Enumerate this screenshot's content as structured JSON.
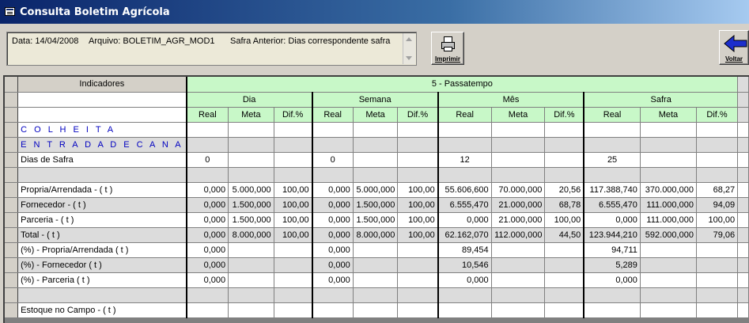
{
  "window": {
    "title": "Consulta Boletim Agrícola"
  },
  "info": {
    "data": "Data: 14/04/2008",
    "arquivo": "Arquivo: BOLETIM_AGR_MOD1",
    "safra": "Safra Anterior: Dias correspondente safra"
  },
  "toolbar": {
    "print_label": "Imprimir",
    "back_label": "Voltar"
  },
  "grid": {
    "indicadores_header": "Indicadores",
    "unit_header": "5 - Passatempo",
    "periods": [
      "Dia",
      "Semana",
      "Mês",
      "Safra"
    ],
    "sub": [
      "Real",
      "Meta",
      "Dif.%"
    ],
    "rows": [
      {
        "label": "C O L H E I T A",
        "section": true,
        "cells": [
          "",
          "",
          "",
          "",
          "",
          "",
          "",
          "",
          "",
          "",
          "",
          ""
        ]
      },
      {
        "label": "E N T R A D A  D E  C A N A",
        "section": true,
        "cells": [
          "",
          "",
          "",
          "",
          "",
          "",
          "",
          "",
          "",
          "",
          "",
          ""
        ]
      },
      {
        "label": "Dias de Safra",
        "cells": [
          "0",
          "",
          "",
          "0",
          "",
          "",
          "12",
          "",
          "",
          "25",
          "",
          ""
        ]
      },
      {
        "label": "",
        "cells": [
          "",
          "",
          "",
          "",
          "",
          "",
          "",
          "",
          "",
          "",
          "",
          ""
        ]
      },
      {
        "label": "Propria/Arrendada - ( t )",
        "cells": [
          "0,000",
          "5.000,000",
          "100,00",
          "0,000",
          "5.000,000",
          "100,00",
          "55.606,600",
          "70.000,000",
          "20,56",
          "117.388,740",
          "370.000,000",
          "68,27"
        ]
      },
      {
        "label": "Fornecedor - ( t )",
        "cells": [
          "0,000",
          "1.500,000",
          "100,00",
          "0,000",
          "1.500,000",
          "100,00",
          "6.555,470",
          "21.000,000",
          "68,78",
          "6.555,470",
          "111.000,000",
          "94,09"
        ]
      },
      {
        "label": "Parceria - ( t )",
        "cells": [
          "0,000",
          "1.500,000",
          "100,00",
          "0,000",
          "1.500,000",
          "100,00",
          "0,000",
          "21.000,000",
          "100,00",
          "0,000",
          "111.000,000",
          "100,00"
        ]
      },
      {
        "label": "Total - ( t )",
        "cells": [
          "0,000",
          "8.000,000",
          "100,00",
          "0,000",
          "8.000,000",
          "100,00",
          "62.162,070",
          "112.000,000",
          "44,50",
          "123.944,210",
          "592.000,000",
          "79,06"
        ]
      },
      {
        "label": "(%) - Propria/Arrendada ( t )",
        "cells": [
          "0,000",
          "",
          "",
          "0,000",
          "",
          "",
          "89,454",
          "",
          "",
          "94,711",
          "",
          ""
        ]
      },
      {
        "label": "(%) - Fornecedor ( t )",
        "cells": [
          "0,000",
          "",
          "",
          "0,000",
          "",
          "",
          "10,546",
          "",
          "",
          "5,289",
          "",
          ""
        ]
      },
      {
        "label": "(%) - Parceria ( t )",
        "cells": [
          "0,000",
          "",
          "",
          "0,000",
          "",
          "",
          "0,000",
          "",
          "",
          "0,000",
          "",
          ""
        ]
      },
      {
        "label": "",
        "cells": [
          "",
          "",
          "",
          "",
          "",
          "",
          "",
          "",
          "",
          "",
          "",
          ""
        ]
      },
      {
        "label": "Estoque no Campo - ( t )",
        "cells": [
          "",
          "",
          "",
          "",
          "",
          "",
          "",
          "",
          "",
          "",
          "",
          ""
        ]
      }
    ]
  }
}
